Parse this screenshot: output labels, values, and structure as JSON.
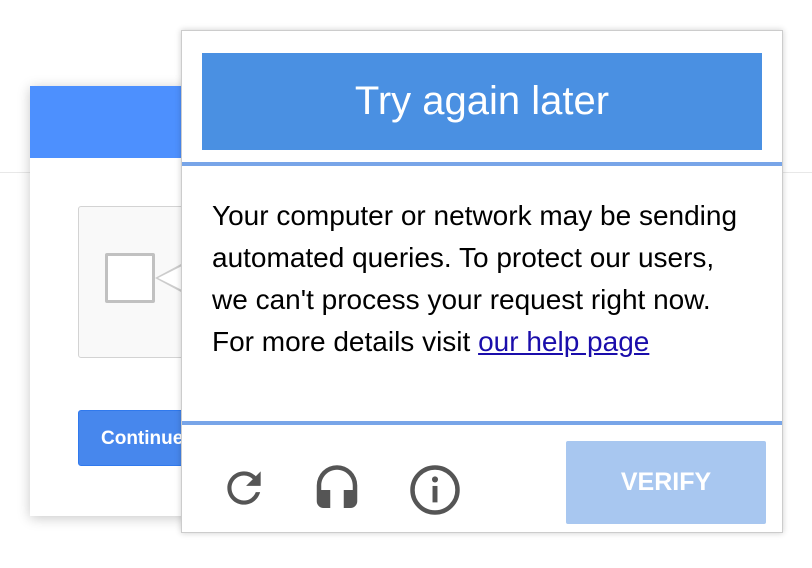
{
  "background": {
    "continue_label": "Continue"
  },
  "popup": {
    "title": "Try again later",
    "message": "Your computer or network may be sending automated queries. To protect our users, we can't process your request right now. For more details visit ",
    "help_link": "our help page",
    "verify_label": "VERIFY"
  },
  "icons": {
    "reload": "reload-icon",
    "audio": "headphones-icon",
    "info": "info-icon"
  },
  "colors": {
    "header_blue": "#4a90e2",
    "divider_blue": "#78a5e8",
    "verify_disabled": "#a8c7f0",
    "link": "#1a0dab",
    "icon_gray": "#555555"
  }
}
